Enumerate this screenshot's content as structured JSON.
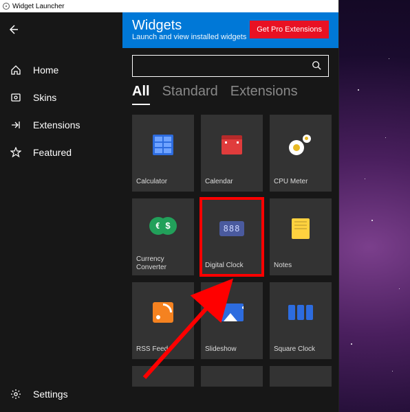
{
  "window": {
    "title": "Widget Launcher"
  },
  "sidebar": {
    "items": [
      {
        "label": "Home"
      },
      {
        "label": "Skins"
      },
      {
        "label": "Extensions"
      },
      {
        "label": "Featured"
      }
    ],
    "settings": "Settings"
  },
  "header": {
    "title": "Widgets",
    "subtitle": "Launch and view installed widgets",
    "pro_button": "Get Pro Extensions"
  },
  "search": {
    "placeholder": ""
  },
  "tabs": [
    {
      "label": "All",
      "active": true
    },
    {
      "label": "Standard",
      "active": false
    },
    {
      "label": "Extensions",
      "active": false
    }
  ],
  "widgets": [
    {
      "label": "Calculator"
    },
    {
      "label": "Calendar"
    },
    {
      "label": "CPU Meter"
    },
    {
      "label": "Currency Converter"
    },
    {
      "label": "Digital Clock"
    },
    {
      "label": "Notes"
    },
    {
      "label": "RSS Feed"
    },
    {
      "label": "Slideshow"
    },
    {
      "label": "Square Clock"
    }
  ],
  "clock_digits": "888"
}
